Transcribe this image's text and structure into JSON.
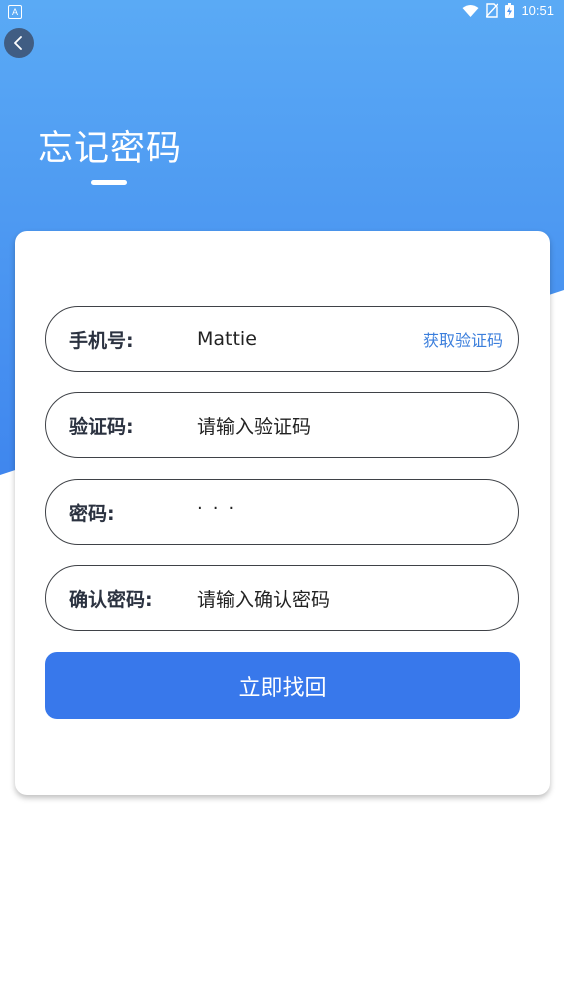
{
  "status_bar": {
    "time": "10:51",
    "left_icon": "A"
  },
  "header": {
    "title": "忘记密码"
  },
  "form": {
    "phone": {
      "label": "手机号:",
      "value": "Mattie",
      "action": "获取验证码"
    },
    "code": {
      "label": "验证码:",
      "placeholder": "请输入验证码"
    },
    "password": {
      "label": "密码:",
      "value": "···"
    },
    "confirm": {
      "label": "确认密码:",
      "placeholder": "请输入确认密码"
    },
    "submit_label": "立即找回"
  },
  "colors": {
    "primary": "#3878eb",
    "gradient_top": "#5aaaf5",
    "gradient_bottom": "#3f86ee",
    "link": "#3c7fdc"
  },
  "icons": [
    "back-arrow-icon",
    "wifi-icon",
    "no-sim-icon",
    "battery-charging-icon"
  ]
}
